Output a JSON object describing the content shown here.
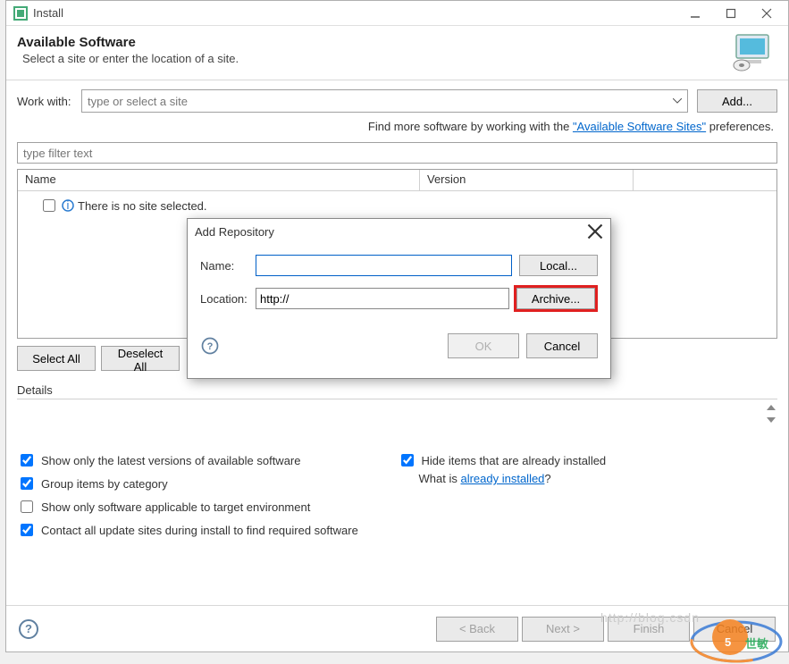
{
  "titlebar": {
    "title": "Install"
  },
  "header": {
    "title": "Available Software",
    "subtitle": "Select a site or enter the location of a site."
  },
  "work": {
    "label": "Work with:",
    "placeholder": "type or select a site",
    "add": "Add..."
  },
  "findmore": {
    "prefix": "Find more software by working with the ",
    "link": "\"Available Software Sites\"",
    "suffix": " preferences."
  },
  "filter": {
    "placeholder": "type filter text"
  },
  "table": {
    "col_name": "Name",
    "col_version": "Version",
    "empty_msg": "There is no site selected.",
    "select_all": "Select All",
    "deselect_all": "Deselect All"
  },
  "details": {
    "label": "Details"
  },
  "options": {
    "latest": "Show only the latest versions of available software",
    "group": "Group items by category",
    "applicable": "Show only software applicable to target environment",
    "contact": "Contact all update sites during install to find required software",
    "hide": "Hide items that are already installed",
    "whatis_prefix": "What is ",
    "whatis_link": "already installed",
    "whatis_suffix": "?"
  },
  "nav": {
    "back": "< Back",
    "next": "Next >",
    "finish": "Finish",
    "cancel": "Cancel"
  },
  "modal": {
    "title": "Add Repository",
    "name_label": "Name:",
    "name_value": "",
    "location_label": "Location:",
    "location_value": "http://",
    "local": "Local...",
    "archive": "Archive...",
    "ok": "OK",
    "cancel": "Cancel"
  },
  "watermark": "http://blog.csdn"
}
